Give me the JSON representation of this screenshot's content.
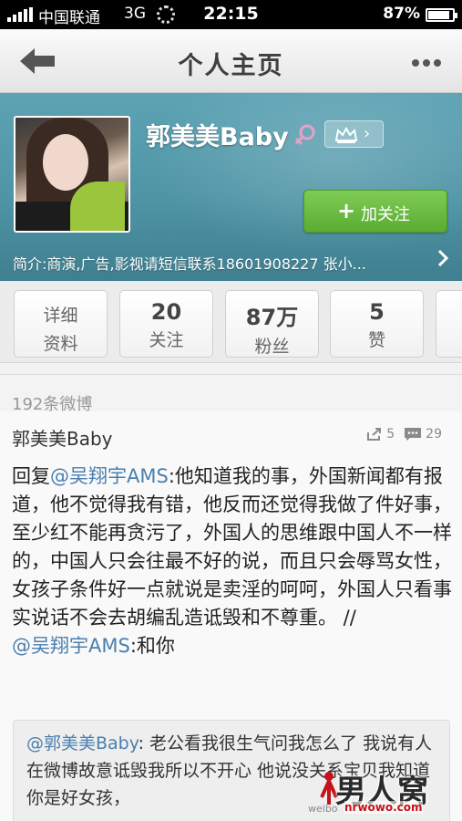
{
  "status_bar": {
    "carrier": "中国联通",
    "network": "3G",
    "time": "22:15",
    "battery_percent": "87%",
    "battery_level": 0.87
  },
  "nav": {
    "title": "个人主页",
    "back_icon": "back-arrow-icon",
    "more_icon": "more-dots-icon"
  },
  "profile": {
    "name": "郭美美Baby",
    "gender_icon": "female-icon",
    "vip_icon": "crown-icon",
    "follow_label": "加关注",
    "bio": "简介:商演,广告,影视请短信联系18601908227 张小..."
  },
  "stats": {
    "detail_line1": "详细",
    "detail_line2": "资料",
    "items": [
      {
        "value": "20",
        "label": "关注"
      },
      {
        "value": "87万",
        "label": "粉丝"
      },
      {
        "value": "5",
        "label": "赞"
      }
    ]
  },
  "feed": {
    "count_label": "192条微博",
    "post": {
      "author": "郭美美Baby",
      "reposts": "5",
      "comments": "29",
      "prefix": "回复",
      "mention1": "@吴翔宇AMS",
      "body": ":他知道我的事，外国新闻都有报道，他不觉得我有错，他反而还觉得我做了件好事，至少红不能再贪污了，外国人的思维跟中国人不一样的，中国人只会往最不好的说，而且只会辱骂女性，女孩子条件好一点就说是卖淫的呵呵，外国人只看事实说话不会去胡编乱造诋毁和不尊重。 //",
      "mention2": "@吴翔宇AMS",
      "tail": ":和你"
    },
    "repost": {
      "mention": "@郭美美Baby",
      "text": ": 老公看我很生气问我怎么了 我说有人在微博故意诋毁我所以不开心 他说没关系宝贝我知道你是好女孩，"
    }
  },
  "watermark": {
    "logo_text": "男人窝",
    "url": "nrwowo.com",
    "small": "weibo"
  },
  "colors": {
    "header_bg": "#4f95a6",
    "follow_green": "#5aac33",
    "mention_blue": "#4a7fae"
  }
}
